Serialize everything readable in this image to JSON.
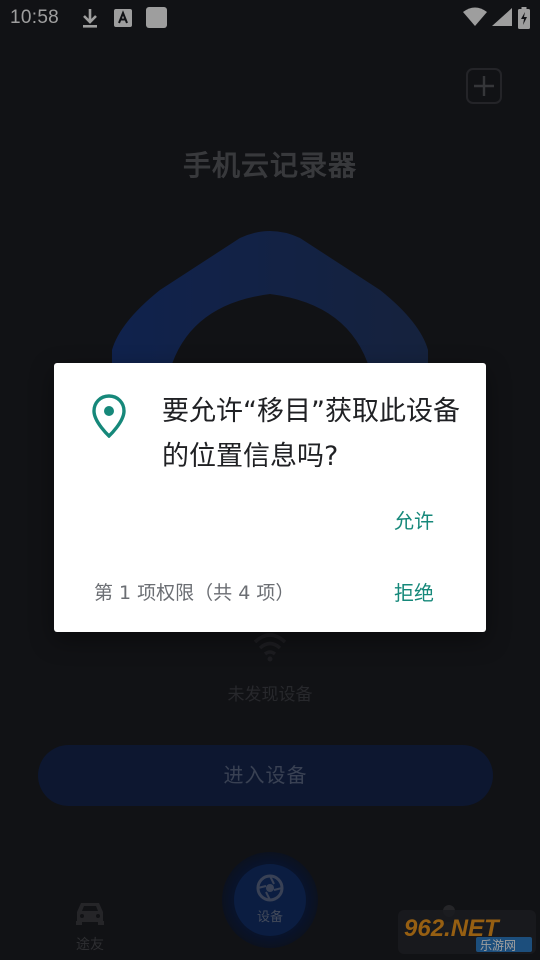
{
  "status_bar": {
    "time": "10:58",
    "icons": [
      "download-icon",
      "a-badge-icon",
      "square-icon",
      "wifi-icon",
      "signal-icon",
      "battery-charging-icon"
    ]
  },
  "app": {
    "title": "手机云记录器",
    "no_device_text": "未发现设备",
    "enter_device_label": "进入设备",
    "add_icon": "plus-icon"
  },
  "bottom_nav": {
    "tuyou_label": "途友",
    "device_label": "设备"
  },
  "dialog": {
    "title": "要允许“移目”获取此设备的位置信息吗?",
    "allow_label": "允许",
    "deny_label": "拒绝",
    "progress_text": "第 1 项权限（共 4 项）",
    "icon": "location-pin-icon"
  },
  "watermark": {
    "text": "962.NET",
    "subtext": "乐游网"
  },
  "colors": {
    "accent": "#16887a",
    "background": "#1c1d22",
    "button": "#15264e"
  }
}
